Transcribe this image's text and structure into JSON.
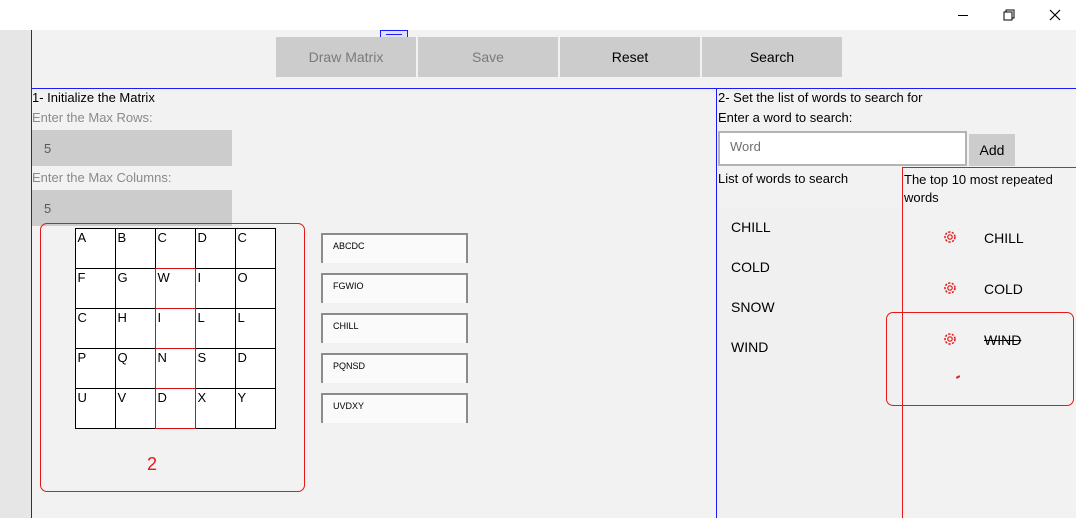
{
  "window": {
    "minimize_glyph": "—",
    "close_glyph": "✕"
  },
  "toolbar": {
    "draw_matrix": "Draw Matrix",
    "save": "Save",
    "reset": "Reset",
    "search": "Search"
  },
  "init_section": {
    "title": "1- Initialize the Matrix",
    "rows_label": "Enter the Max Rows:",
    "rows_value": "5",
    "cols_label": "Enter the Max Columns:",
    "cols_value": "5"
  },
  "matrix": {
    "rows": [
      [
        "A",
        "B",
        "C",
        "D",
        "C"
      ],
      [
        "F",
        "G",
        "W",
        "I",
        "O"
      ],
      [
        "C",
        "H",
        "I",
        "L",
        "L"
      ],
      [
        "P",
        "Q",
        "N",
        "S",
        "D"
      ],
      [
        "U",
        "V",
        "D",
        "X",
        "Y"
      ]
    ],
    "row_strings": [
      "ABCDC",
      "FGWIO",
      "CHILL",
      "PQNSD",
      "UVDXY"
    ]
  },
  "annotation_number": "2",
  "search_section": {
    "title": "2- Set the list of words to search for",
    "word_label": "Enter a word to search:",
    "word_placeholder": "Word",
    "add_label": "Add",
    "list_header": "List of words to search",
    "words": [
      "CHILL",
      "COLD",
      "SNOW",
      "WIND"
    ],
    "top_header_line1": "The top 10 most repeated",
    "top_header_line2": "words",
    "top_words": [
      "CHILL",
      "COLD",
      "WIND"
    ]
  },
  "colors": {
    "accent_blue": "#1a1aff",
    "highlight_red": "#e61717",
    "button_gray": "#cccccc"
  }
}
